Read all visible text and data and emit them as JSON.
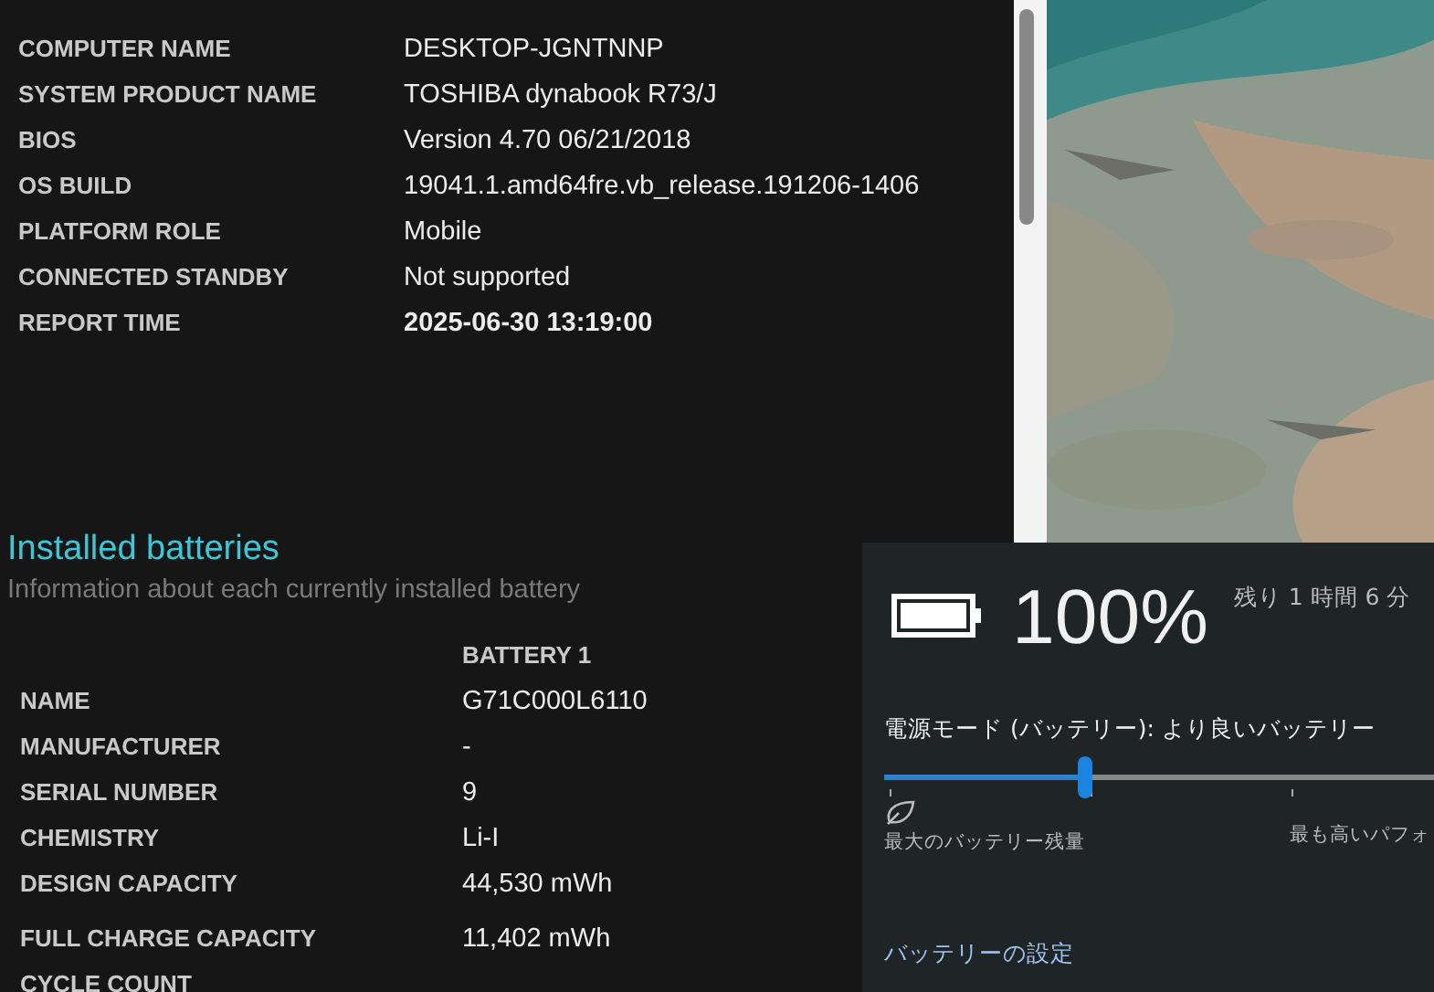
{
  "system_info": [
    {
      "label": "COMPUTER NAME",
      "value": "DESKTOP-JGNTNNP",
      "bold": false
    },
    {
      "label": "SYSTEM PRODUCT NAME",
      "value": "TOSHIBA dynabook R73/J",
      "bold": false
    },
    {
      "label": "BIOS",
      "value": "Version 4.70 06/21/2018",
      "bold": false
    },
    {
      "label": "OS BUILD",
      "value": "19041.1.amd64fre.vb_release.191206-1406",
      "bold": false
    },
    {
      "label": "PLATFORM ROLE",
      "value": "Mobile",
      "bold": false
    },
    {
      "label": "CONNECTED STANDBY",
      "value": "Not supported",
      "bold": false
    },
    {
      "label": "REPORT TIME",
      "value": "2025-06-30  13:19:00",
      "bold": true
    }
  ],
  "installed_batteries": {
    "title": "Installed batteries",
    "subtitle": "Information about each currently installed battery",
    "column_header": "BATTERY 1",
    "rows": [
      {
        "label": "NAME",
        "value": "G71C000L6110"
      },
      {
        "label": "MANUFACTURER",
        "value": "-"
      },
      {
        "label": "SERIAL NUMBER",
        "value": "9"
      },
      {
        "label": "CHEMISTRY",
        "value": "Li-I"
      },
      {
        "label": "DESIGN CAPACITY",
        "value": "44,530 mWh"
      },
      {
        "label": "FULL CHARGE CAPACITY",
        "value": "11,402 mWh"
      },
      {
        "label": "CYCLE COUNT",
        "value": ""
      }
    ]
  },
  "battery_flyout": {
    "percent": "100%",
    "remaining": "残り 1 時間 6 分",
    "power_mode": "電源モード (バッテリー): より良いバッテリー",
    "slider": {
      "level": 0.333
    },
    "min_label": "最大のバッテリー残量",
    "max_label": "最も高いパフォ",
    "settings_link": "バッテリーの設定"
  }
}
